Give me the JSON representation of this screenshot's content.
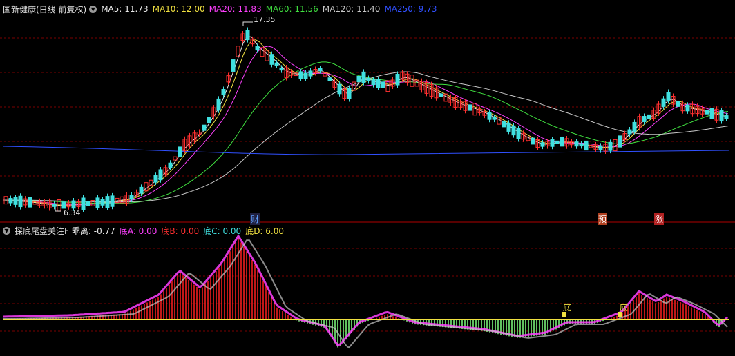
{
  "main_panel": {
    "title": "国新健康(日线 前复权)",
    "indicators": [
      {
        "label": "MA5: 11.73",
        "color": "#e8e8e8"
      },
      {
        "label": "MA10: 12.00",
        "color": "#f0e040"
      },
      {
        "label": "MA20: 11.83",
        "color": "#ff40ff"
      },
      {
        "label": "MA60: 11.56",
        "color": "#40e040"
      },
      {
        "label": "MA120: 11.40",
        "color": "#c8c8c8"
      },
      {
        "label": "MA250: 9.73",
        "color": "#3050ff"
      }
    ],
    "high_label": "17.35",
    "low_label": "6.34",
    "markers": [
      {
        "text": "财",
        "color": "#60a0ff"
      },
      {
        "text": "预",
        "color": "#ffffff"
      },
      {
        "text": "涨",
        "color": "#ffffff"
      }
    ]
  },
  "sub_panel": {
    "title": "探底尾盘关注F",
    "indicators": [
      {
        "label": "乖离: -0.77",
        "color": "#e8e8e8"
      },
      {
        "label": "底A: 0.00",
        "color": "#ff40ff"
      },
      {
        "label": "底B: 0.00",
        "color": "#ff3030"
      },
      {
        "label": "底C: 0.00",
        "color": "#40e0e0"
      },
      {
        "label": "底D: 6.00",
        "color": "#f0e040"
      }
    ],
    "signals": [
      "底",
      "底"
    ]
  },
  "colors": {
    "up": "#ff3030",
    "down": "#40e0e0",
    "grid": "#8b0000"
  }
}
